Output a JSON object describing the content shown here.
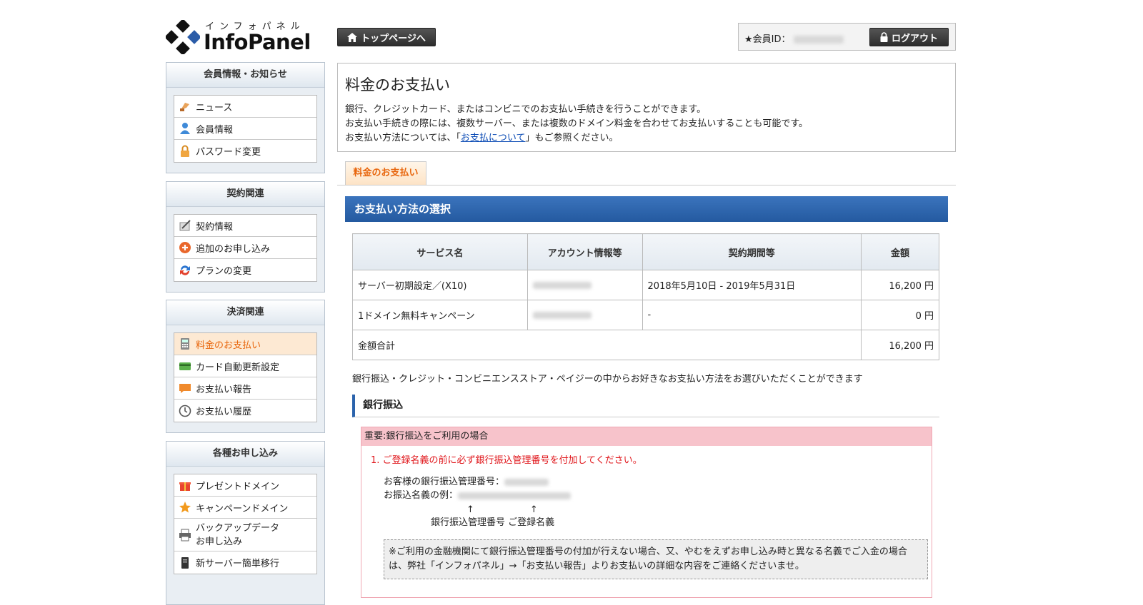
{
  "logo": {
    "kana": "インフォパネル",
    "name": "InfoPanel"
  },
  "header": {
    "top_button": "トップページへ",
    "member_label": "★会員ID：",
    "logout_button": "ログアウト"
  },
  "sidebar": [
    {
      "title": "会員情報・お知らせ",
      "items": [
        {
          "label": "ニュース",
          "icon": "news-icon"
        },
        {
          "label": "会員情報",
          "icon": "user-icon"
        },
        {
          "label": "パスワード変更",
          "icon": "lock-icon"
        }
      ]
    },
    {
      "title": "契約関連",
      "items": [
        {
          "label": "契約情報",
          "icon": "contract-icon"
        },
        {
          "label": "追加のお申し込み",
          "icon": "plus-icon"
        },
        {
          "label": "プランの変更",
          "icon": "refresh-icon"
        }
      ]
    },
    {
      "title": "決済関連",
      "items": [
        {
          "label": "料金のお支払い",
          "icon": "calculator-icon"
        },
        {
          "label": "カード自動更新設定",
          "icon": "card-icon"
        },
        {
          "label": "お支払い報告",
          "icon": "message-icon"
        },
        {
          "label": "お支払い履歴",
          "icon": "clock-icon"
        }
      ]
    },
    {
      "title": "各種お申し込み",
      "items": [
        {
          "label": "プレゼントドメイン",
          "icon": "gift-icon"
        },
        {
          "label": "キャンペーンドメイン",
          "icon": "star-icon"
        },
        {
          "label": "バックアップデータ\nお申し込み",
          "icon": "printer-icon"
        },
        {
          "label": "新サーバー簡単移行",
          "icon": "server-icon"
        }
      ]
    }
  ],
  "main": {
    "title": "料金のお支払い",
    "intro_lines": [
      "銀行、クレジットカード、またはコンビニでのお支払い手続きを行うことができます。",
      "お支払い手続きの際には、複数サーバー、または複数のドメイン料金を合わせてお支払いすることも可能です。"
    ],
    "intro_line3_before": "お支払い方法については、「",
    "intro_link": "お支払について",
    "intro_line3_after": "」もご参照ください。",
    "tab": "料金のお支払い",
    "section_title": "お支払い方法の選択",
    "table": {
      "headers": [
        "サービス名",
        "アカウント情報等",
        "契約期間等",
        "金額"
      ],
      "rows": [
        [
          "サーバー初期設定／(X10)",
          "",
          "2018年5月10日 - 2019年5月31日",
          "16,200 円"
        ],
        [
          "1ドメイン無料キャンペーン",
          "",
          "-",
          "0 円"
        ]
      ],
      "total_label": "金額合計",
      "total_value": "16,200 円"
    },
    "method_note": "銀行振込・クレジット・コンビニエンスストア・ペイジーの中からお好きなお支払い方法をお選びいただくことができます",
    "bank_title": "銀行振込",
    "important": {
      "head": "重要:銀行振込をご利用の場合",
      "red_line": "1. ご登録名義の前に必ず銀行振込管理番号を付加してください。",
      "line1": "お客様の銀行振込管理番号：",
      "line2": "お振込名義の例：",
      "arrows": "↑　　　　　　↑",
      "arrow_labels": "銀行振込管理番号 ご登録名義",
      "notice": "※ご利用の金融機関にて銀行振込管理番号の付加が行えない場合、又、やむをえずお申し込み時と異なる名義でご入金の場合は、弊社「インフォパネル」→「お支払い報告」よりお支払いの詳細な内容をご連絡くださいませ。"
    }
  }
}
